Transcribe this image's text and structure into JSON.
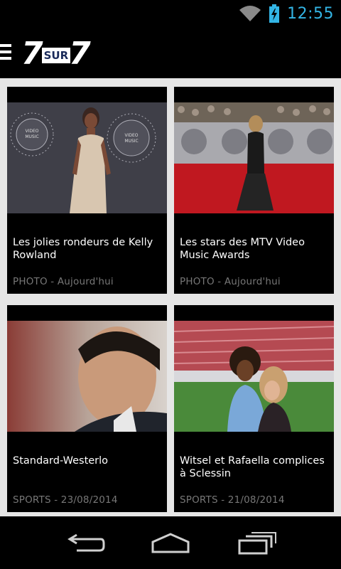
{
  "status_bar": {
    "time": "12:55",
    "icons": [
      "wifi-icon",
      "battery-charging-icon"
    ],
    "accent_color": "#33b5e5"
  },
  "app_bar": {
    "menu_icon": "menu-icon",
    "logo": {
      "left": "7",
      "middle": "SUR",
      "right": "7"
    }
  },
  "articles": [
    {
      "title": "Les jolies rondeurs de Kelly Rowland",
      "meta": "PHOTO - Aujourd'hui"
    },
    {
      "title": "Les stars des MTV Video Music Awards",
      "meta": "PHOTO - Aujourd'hui"
    },
    {
      "title": "Standard-Westerlo",
      "meta": "SPORTS - 23/08/2014"
    },
    {
      "title": "Witsel et Rafaella complices à Sclessin",
      "meta": "SPORTS - 21/08/2014"
    }
  ],
  "nav_bar": {
    "buttons": [
      "back-icon",
      "home-icon",
      "recent-apps-icon"
    ]
  },
  "colors": {
    "background": "#000000",
    "content_bg": "#e6e6e6",
    "meta_text": "#777777"
  }
}
